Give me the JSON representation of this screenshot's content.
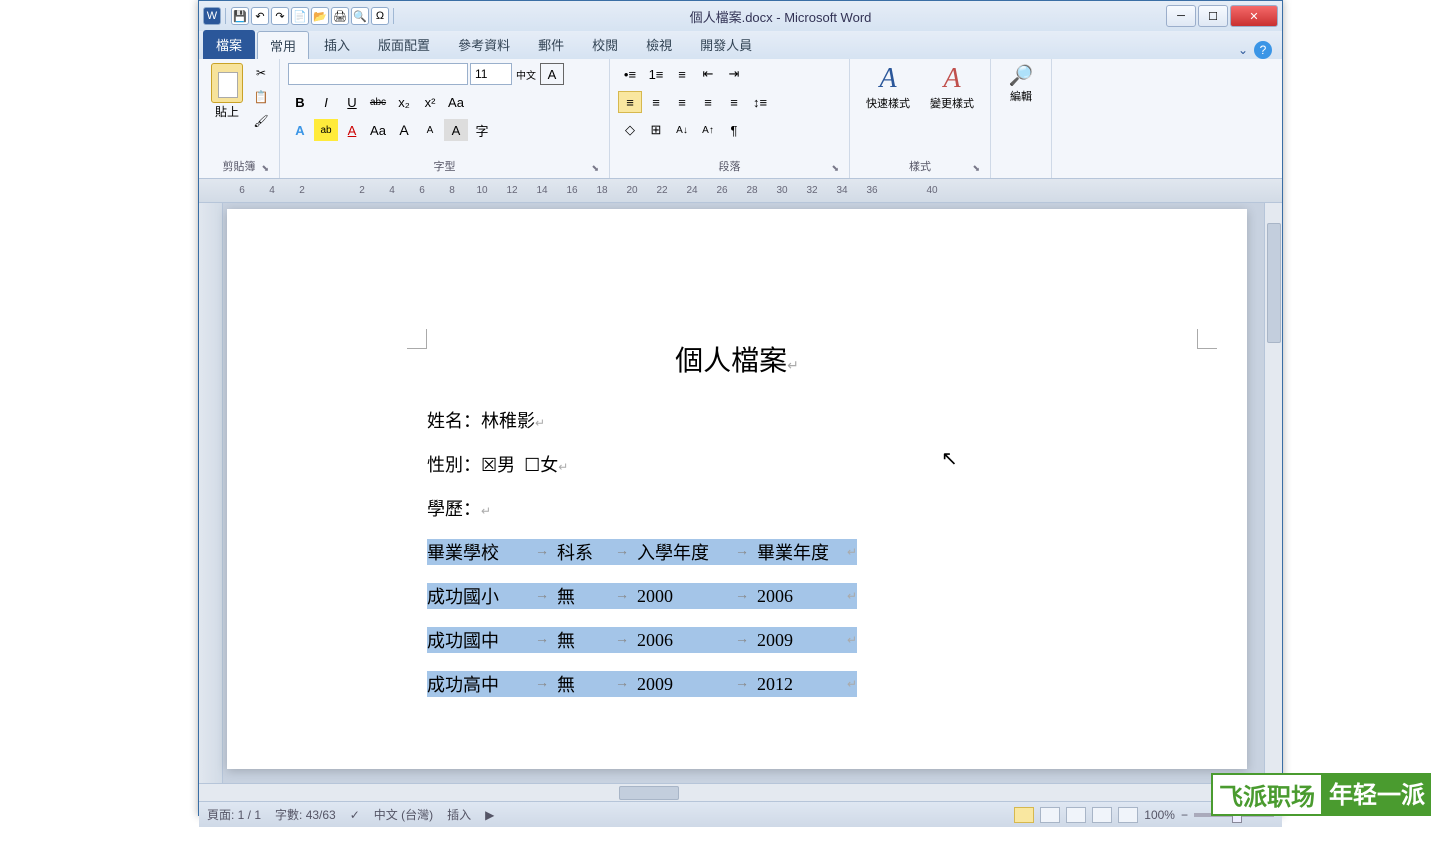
{
  "app": {
    "title": "個人檔案.docx - Microsoft Word"
  },
  "qat": {
    "save": "💾",
    "undo": "↶",
    "redo": "↷",
    "new": "📄",
    "open": "📂",
    "print": "🖨",
    "preview": "🔍",
    "omega": "Ω"
  },
  "tabs": {
    "file": "檔案",
    "home": "常用",
    "insert": "插入",
    "layout": "版面配置",
    "references": "參考資料",
    "mailings": "郵件",
    "review": "校閱",
    "view": "檢視",
    "developer": "開發人員"
  },
  "ribbon": {
    "clipboard": {
      "paste": "貼上",
      "label": "剪貼簿"
    },
    "font": {
      "size": "11",
      "bold": "B",
      "italic": "I",
      "underline": "U",
      "strike": "abc",
      "sub": "x₂",
      "sup": "x²",
      "clear": "⌫",
      "effects": "A",
      "highlight": "ab",
      "color": "A",
      "case": "Aa",
      "grow": "A",
      "shrink": "A",
      "box": "A",
      "char": "字",
      "label": "字型",
      "phonetic": "中文",
      "charborder": "A"
    },
    "paragraph": {
      "bullets": "≡",
      "numbers": "≡",
      "multi": "≡",
      "indentL": "≡",
      "indentR": "≡",
      "alignL": "≡",
      "alignC": "≡",
      "alignR": "≡",
      "justify": "≡",
      "distrib": "≡",
      "spacing": "↕",
      "fill": "◇",
      "borders": "⊞",
      "sort": "A↓",
      "show": "¶",
      "label": "段落"
    },
    "styles": {
      "quick": "快速樣式",
      "change": "變更樣式",
      "label": "樣式"
    },
    "editing": {
      "find": "編輯",
      "icon": "🔍"
    }
  },
  "ruler": [
    "6",
    "4",
    "2",
    "",
    "2",
    "4",
    "6",
    "8",
    "10",
    "12",
    "14",
    "16",
    "18",
    "20",
    "22",
    "24",
    "26",
    "28",
    "30",
    "32",
    "34",
    "36",
    "",
    "40"
  ],
  "document": {
    "title": "個人檔案",
    "name_label": "姓名：",
    "name_value": "林稚影",
    "gender_label": "性別：",
    "gender_male": "☒男",
    "gender_female": "☐女",
    "edu_label": "學歷：",
    "table": {
      "headers": [
        "畢業學校",
        "科系",
        "入學年度",
        "畢業年度"
      ],
      "rows": [
        [
          "成功國小",
          "無",
          "2000",
          "2006"
        ],
        [
          "成功國中",
          "無",
          "2006",
          "2009"
        ],
        [
          "成功高中",
          "無",
          "2009",
          "2012"
        ]
      ]
    }
  },
  "status": {
    "page": "頁面: 1 / 1",
    "words": "字數: 43/63",
    "lang": "中文 (台灣)",
    "insert": "插入",
    "zoom": "100%"
  },
  "watermark": {
    "a": "飞派职场",
    "b": "年轻一派"
  }
}
